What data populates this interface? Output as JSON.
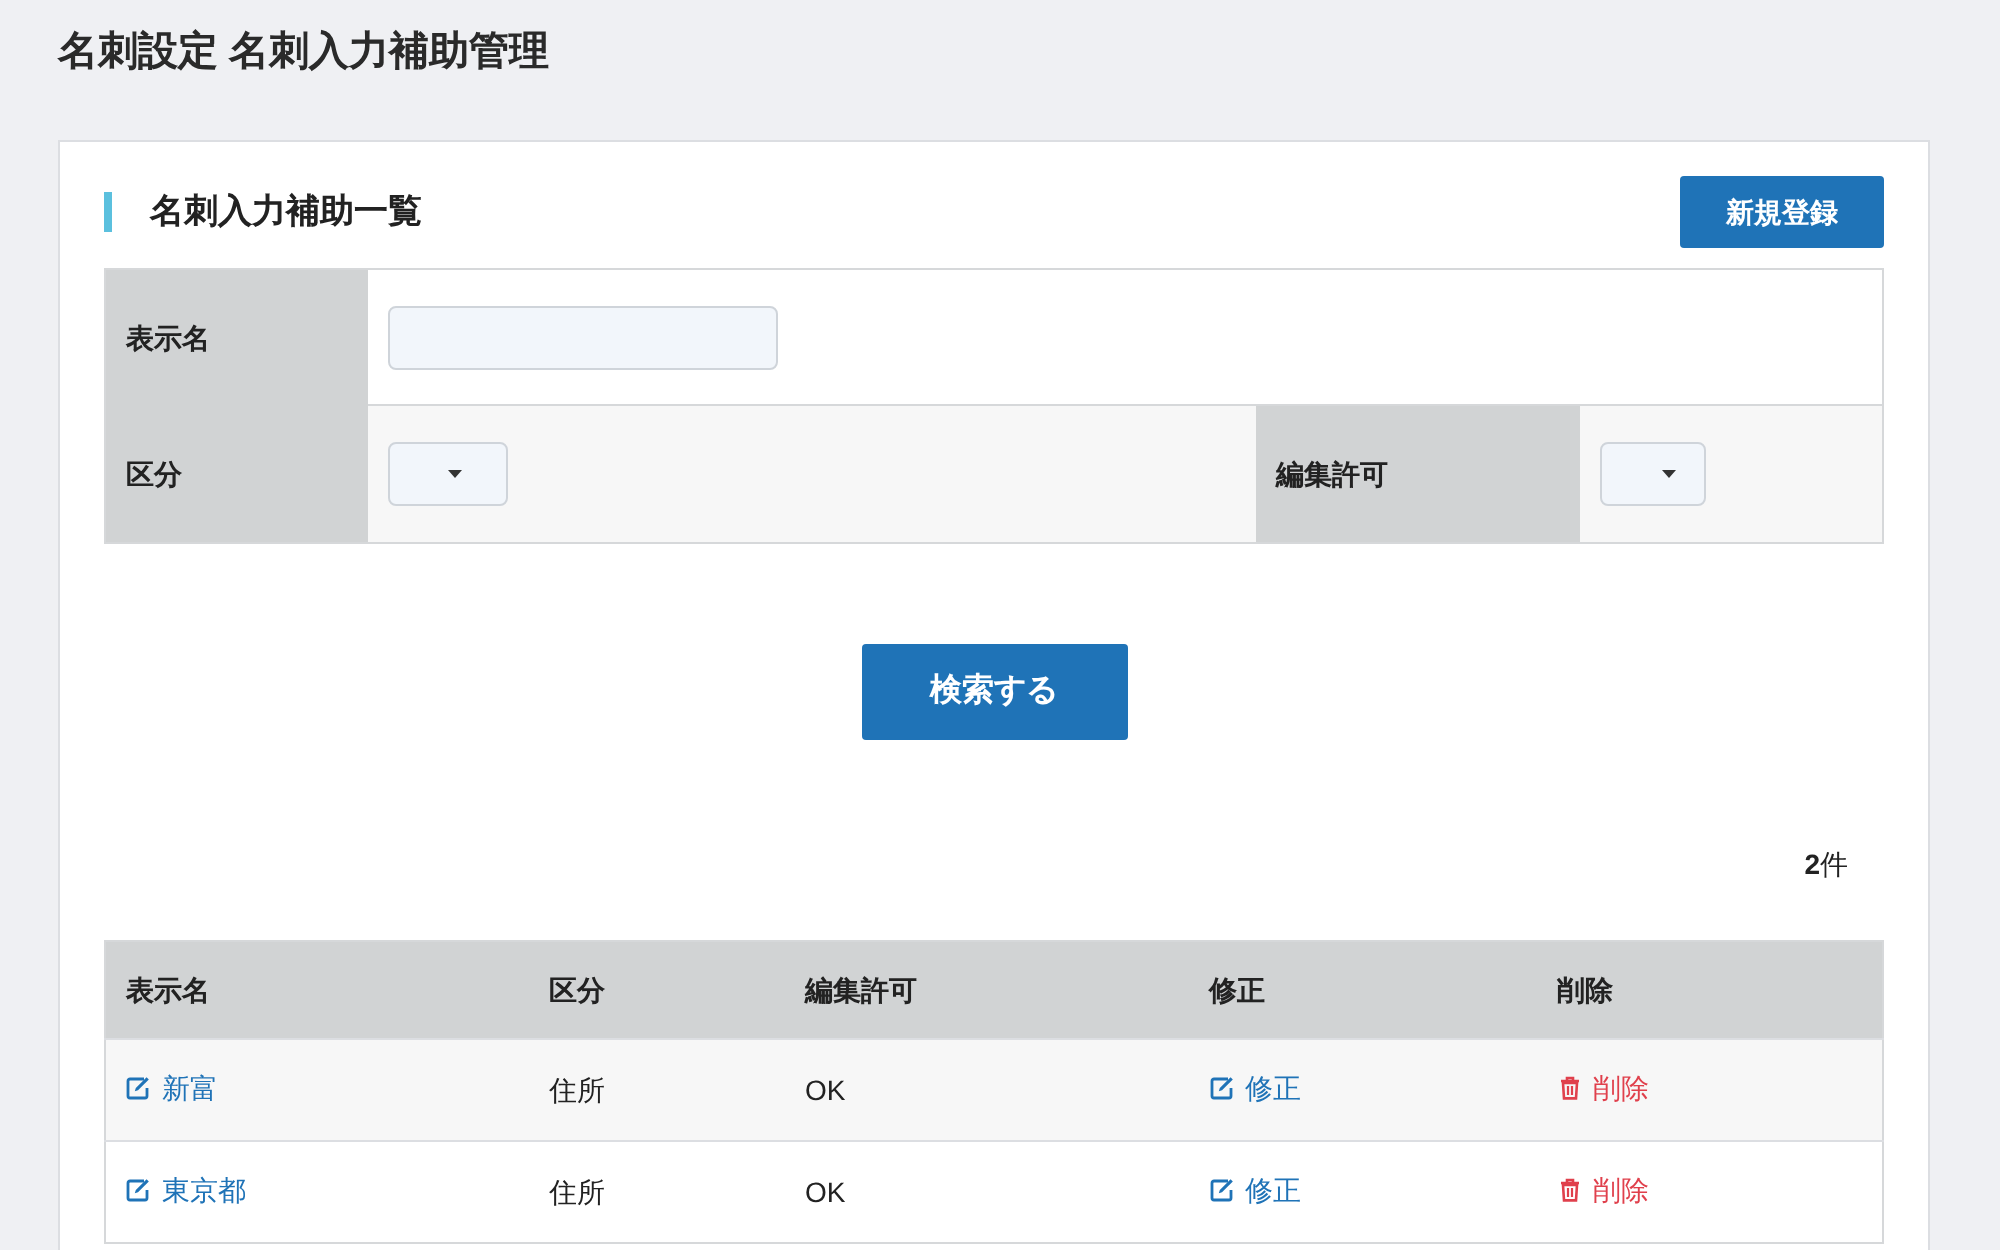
{
  "page_title": "名刺設定 名刺入力補助管理",
  "panel": {
    "heading": "名刺入力補助一覧",
    "new_button": "新規登録",
    "search_form": {
      "fields": [
        {
          "label": "表示名",
          "kind": "text"
        },
        {
          "label": "区分",
          "kind": "select"
        },
        {
          "label": "編集許可",
          "kind": "select"
        }
      ]
    },
    "search_button": "検索する",
    "result_count": "**2**件",
    "table": {
      "columns": [
        "表示名",
        "区分",
        "編集許可",
        "修正",
        "削除"
      ],
      "rows": [
        {
          "display_name": "新富",
          "category": "住所",
          "edit_permission": "OK",
          "edit": "修正",
          "delete": "削除"
        },
        {
          "display_name": "東京都",
          "category": "住所",
          "edit_permission": "OK",
          "edit": "修正",
          "delete": "削除"
        }
      ]
    }
  }
}
